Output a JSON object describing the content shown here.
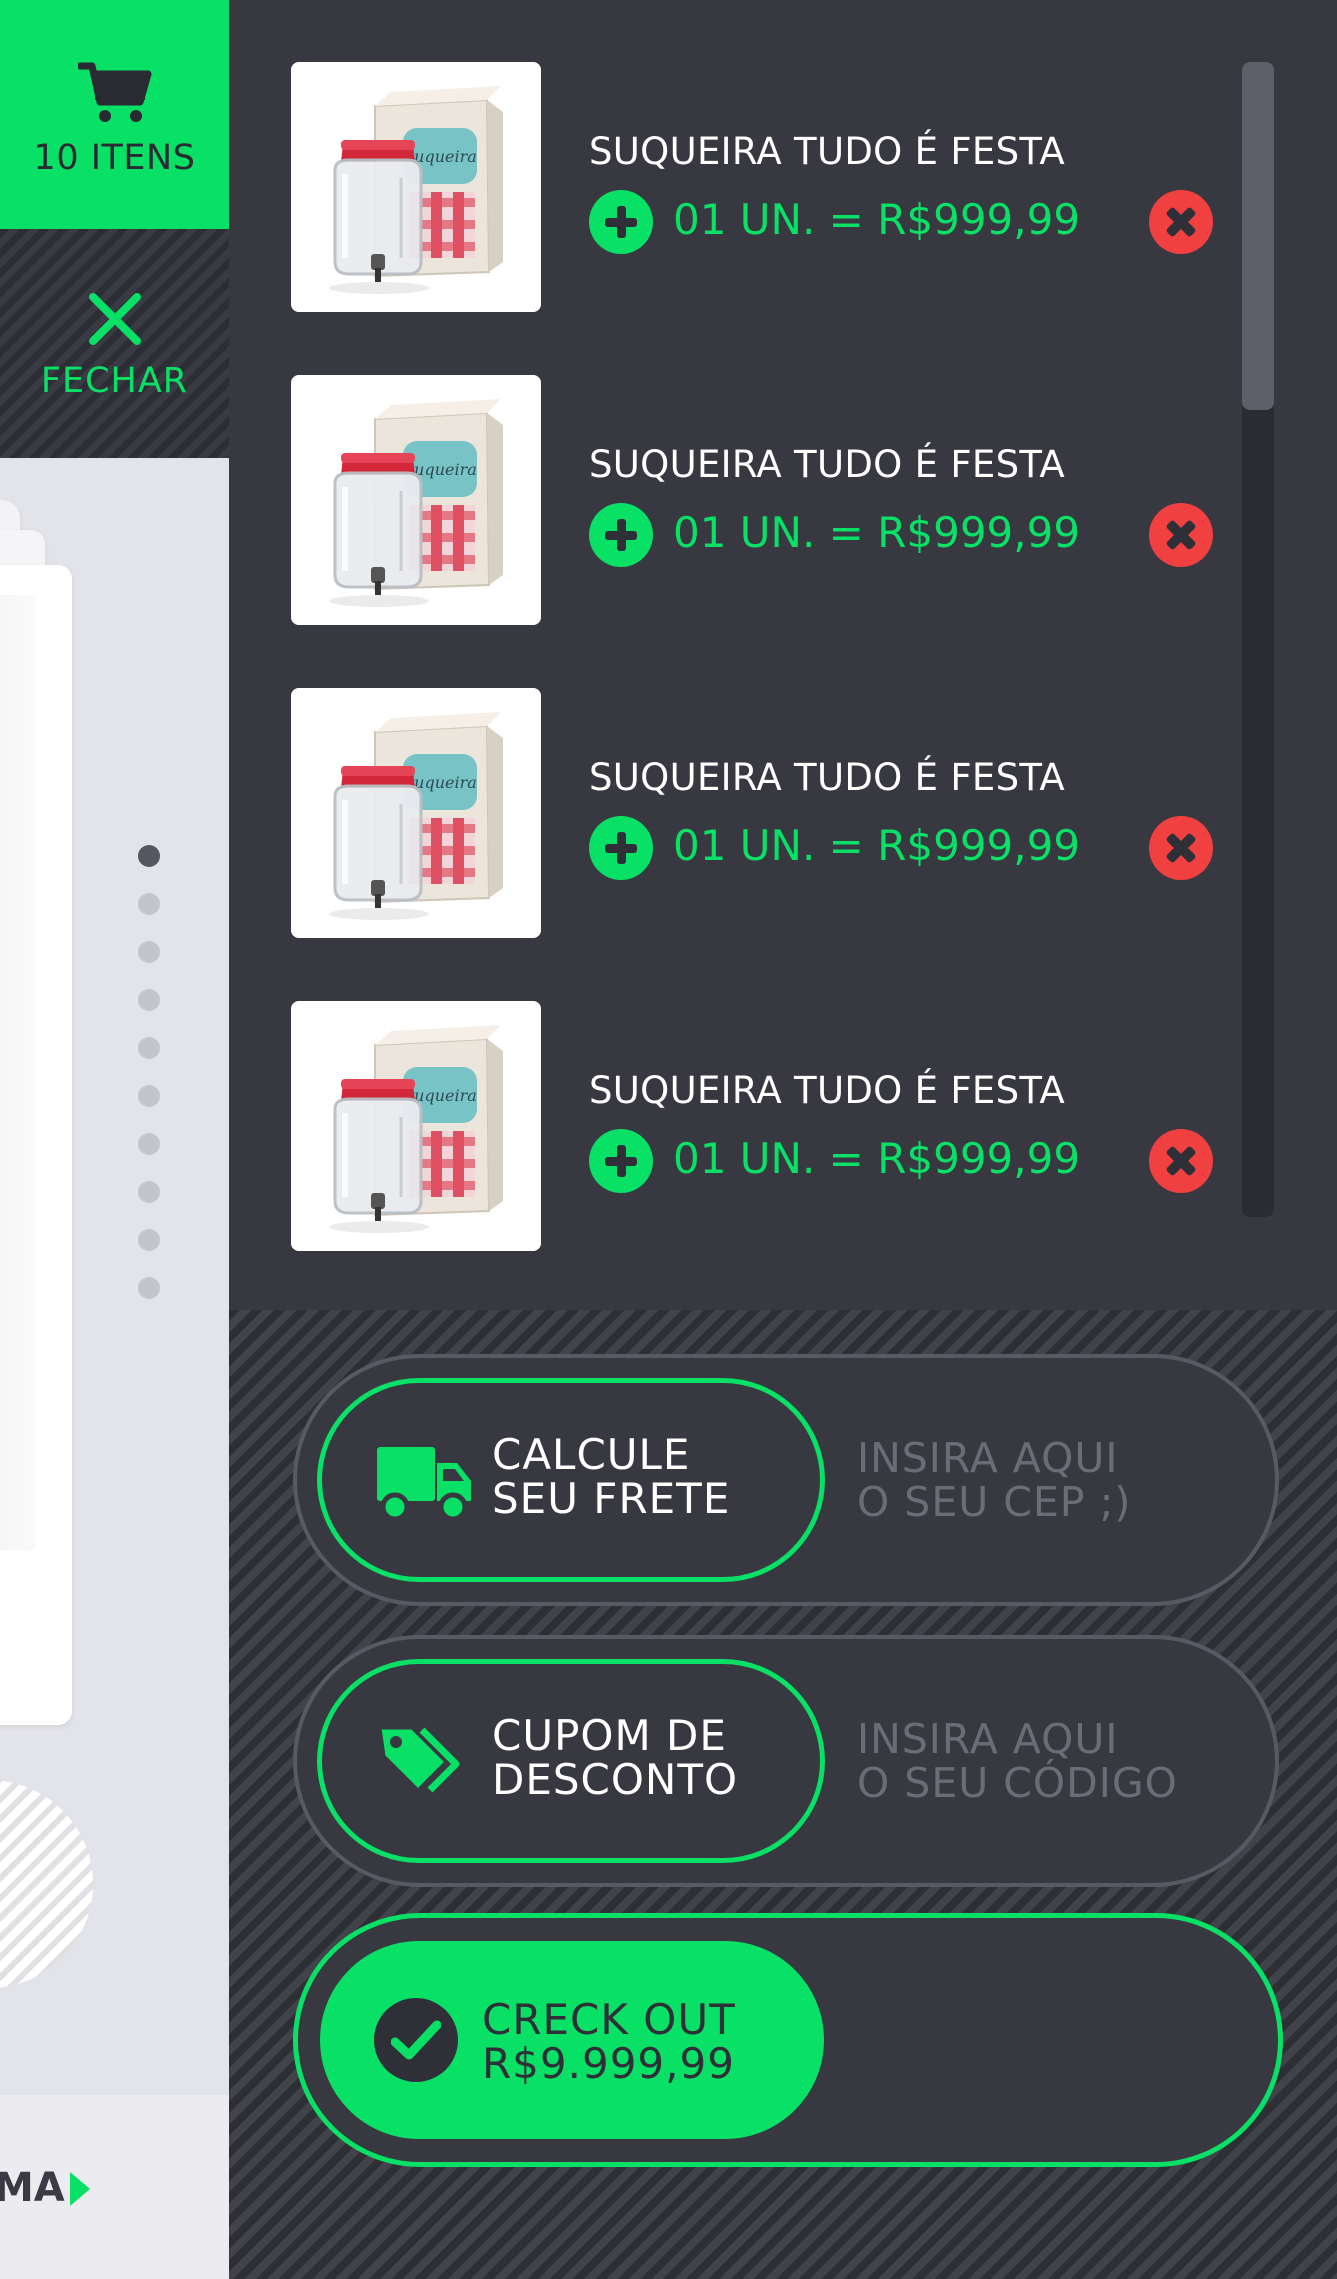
{
  "cart_tab": {
    "count_label": "10 ITENS"
  },
  "close_tab": {
    "label": "FECHAR"
  },
  "left_page": {
    "bottom_label": "MA",
    "dots": 10,
    "active_dot": 0
  },
  "cart": {
    "items": [
      {
        "name": "SUQUEIRA TUDO É FESTA",
        "price": "01 UN. = R$999,99",
        "image": "suqueira-product"
      },
      {
        "name": "SUQUEIRA TUDO É FESTA",
        "price": "01 UN. = R$999,99",
        "image": "suqueira-product"
      },
      {
        "name": "SUQUEIRA TUDO É FESTA",
        "price": "01 UN. = R$999,99",
        "image": "suqueira-product"
      },
      {
        "name": "SUQUEIRA TUDO É FESTA",
        "price": "01 UN. = R$999,99",
        "image": "suqueira-product"
      }
    ],
    "scroll_position": 0
  },
  "shipping": {
    "button_line1": "CALCULE",
    "button_line2": "SEU FRETE",
    "placeholder": "INSIRA AQUI\nO SEU CEP ;)",
    "icon": "truck-icon"
  },
  "coupon": {
    "button_line1": "CUPOM DE",
    "button_line2": "DESCONTO",
    "placeholder": "INSIRA AQUI\nO SEU CÓDIGO",
    "icon": "tag-icon"
  },
  "checkout": {
    "line1": "CRECK OUT",
    "line2": "R$9.999,99",
    "icon": "check-icon"
  },
  "colors": {
    "accent": "#08e066",
    "panel": "#383841",
    "remove": "#f04040"
  }
}
